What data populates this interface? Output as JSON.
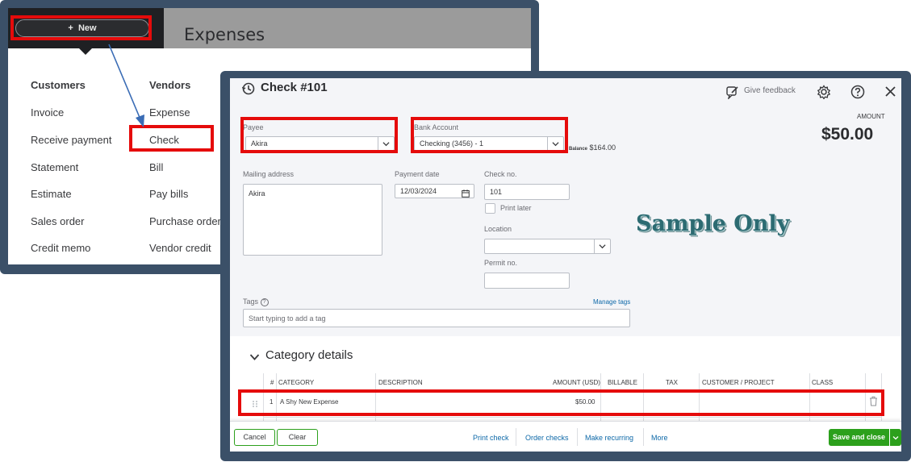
{
  "new_menu": {
    "new_button_label": "New",
    "page_title": "Expenses",
    "customers": {
      "heading": "Customers",
      "items": [
        "Invoice",
        "Receive payment",
        "Statement",
        "Estimate",
        "Sales order",
        "Credit memo"
      ]
    },
    "vendors": {
      "heading": "Vendors",
      "items": [
        "Expense",
        "Check",
        "Bill",
        "Pay bills",
        "Purchase order",
        "Vendor credit"
      ]
    }
  },
  "check_form": {
    "title": "Check #101",
    "give_feedback": "Give feedback",
    "amount_label": "AMOUNT",
    "amount_value": "$50.00",
    "payee_label": "Payee",
    "payee_value": "Akira",
    "bank_account_label": "Bank Account",
    "bank_account_value": "Checking (3456) - 1",
    "balance_label": "Balance",
    "balance_value": "$164.00",
    "mailing_address_label": "Mailing address",
    "mailing_address_value": "Akira",
    "payment_date_label": "Payment date",
    "payment_date_value": "12/03/2024",
    "check_no_label": "Check no.",
    "check_no_value": "101",
    "print_later_label": "Print later",
    "location_label": "Location",
    "permit_no_label": "Permit no.",
    "watermark": "Sample Only",
    "tags_label": "Tags",
    "manage_tags": "Manage tags",
    "tags_placeholder": "Start typing to add a tag",
    "category_section_title": "Category details",
    "table": {
      "headers": [
        "#",
        "CATEGORY",
        "DESCRIPTION",
        "AMOUNT (USD)",
        "BILLABLE",
        "TAX",
        "CUSTOMER / PROJECT",
        "CLASS"
      ],
      "rows": [
        {
          "num": "1",
          "category": "A Shy New Expense",
          "description": "",
          "amount": "$50.00"
        }
      ]
    },
    "footer": {
      "cancel": "Cancel",
      "clear": "Clear",
      "print_check": "Print check",
      "order_checks": "Order checks",
      "make_recurring": "Make recurring",
      "more": "More",
      "save_and_close": "Save and close"
    }
  },
  "colors": {
    "frame": "#3b5068",
    "highlight_red": "#e50b0b",
    "primary_green": "#2ca01c",
    "link_blue": "#0d68a8",
    "arrow_blue": "#3a6cb5"
  }
}
